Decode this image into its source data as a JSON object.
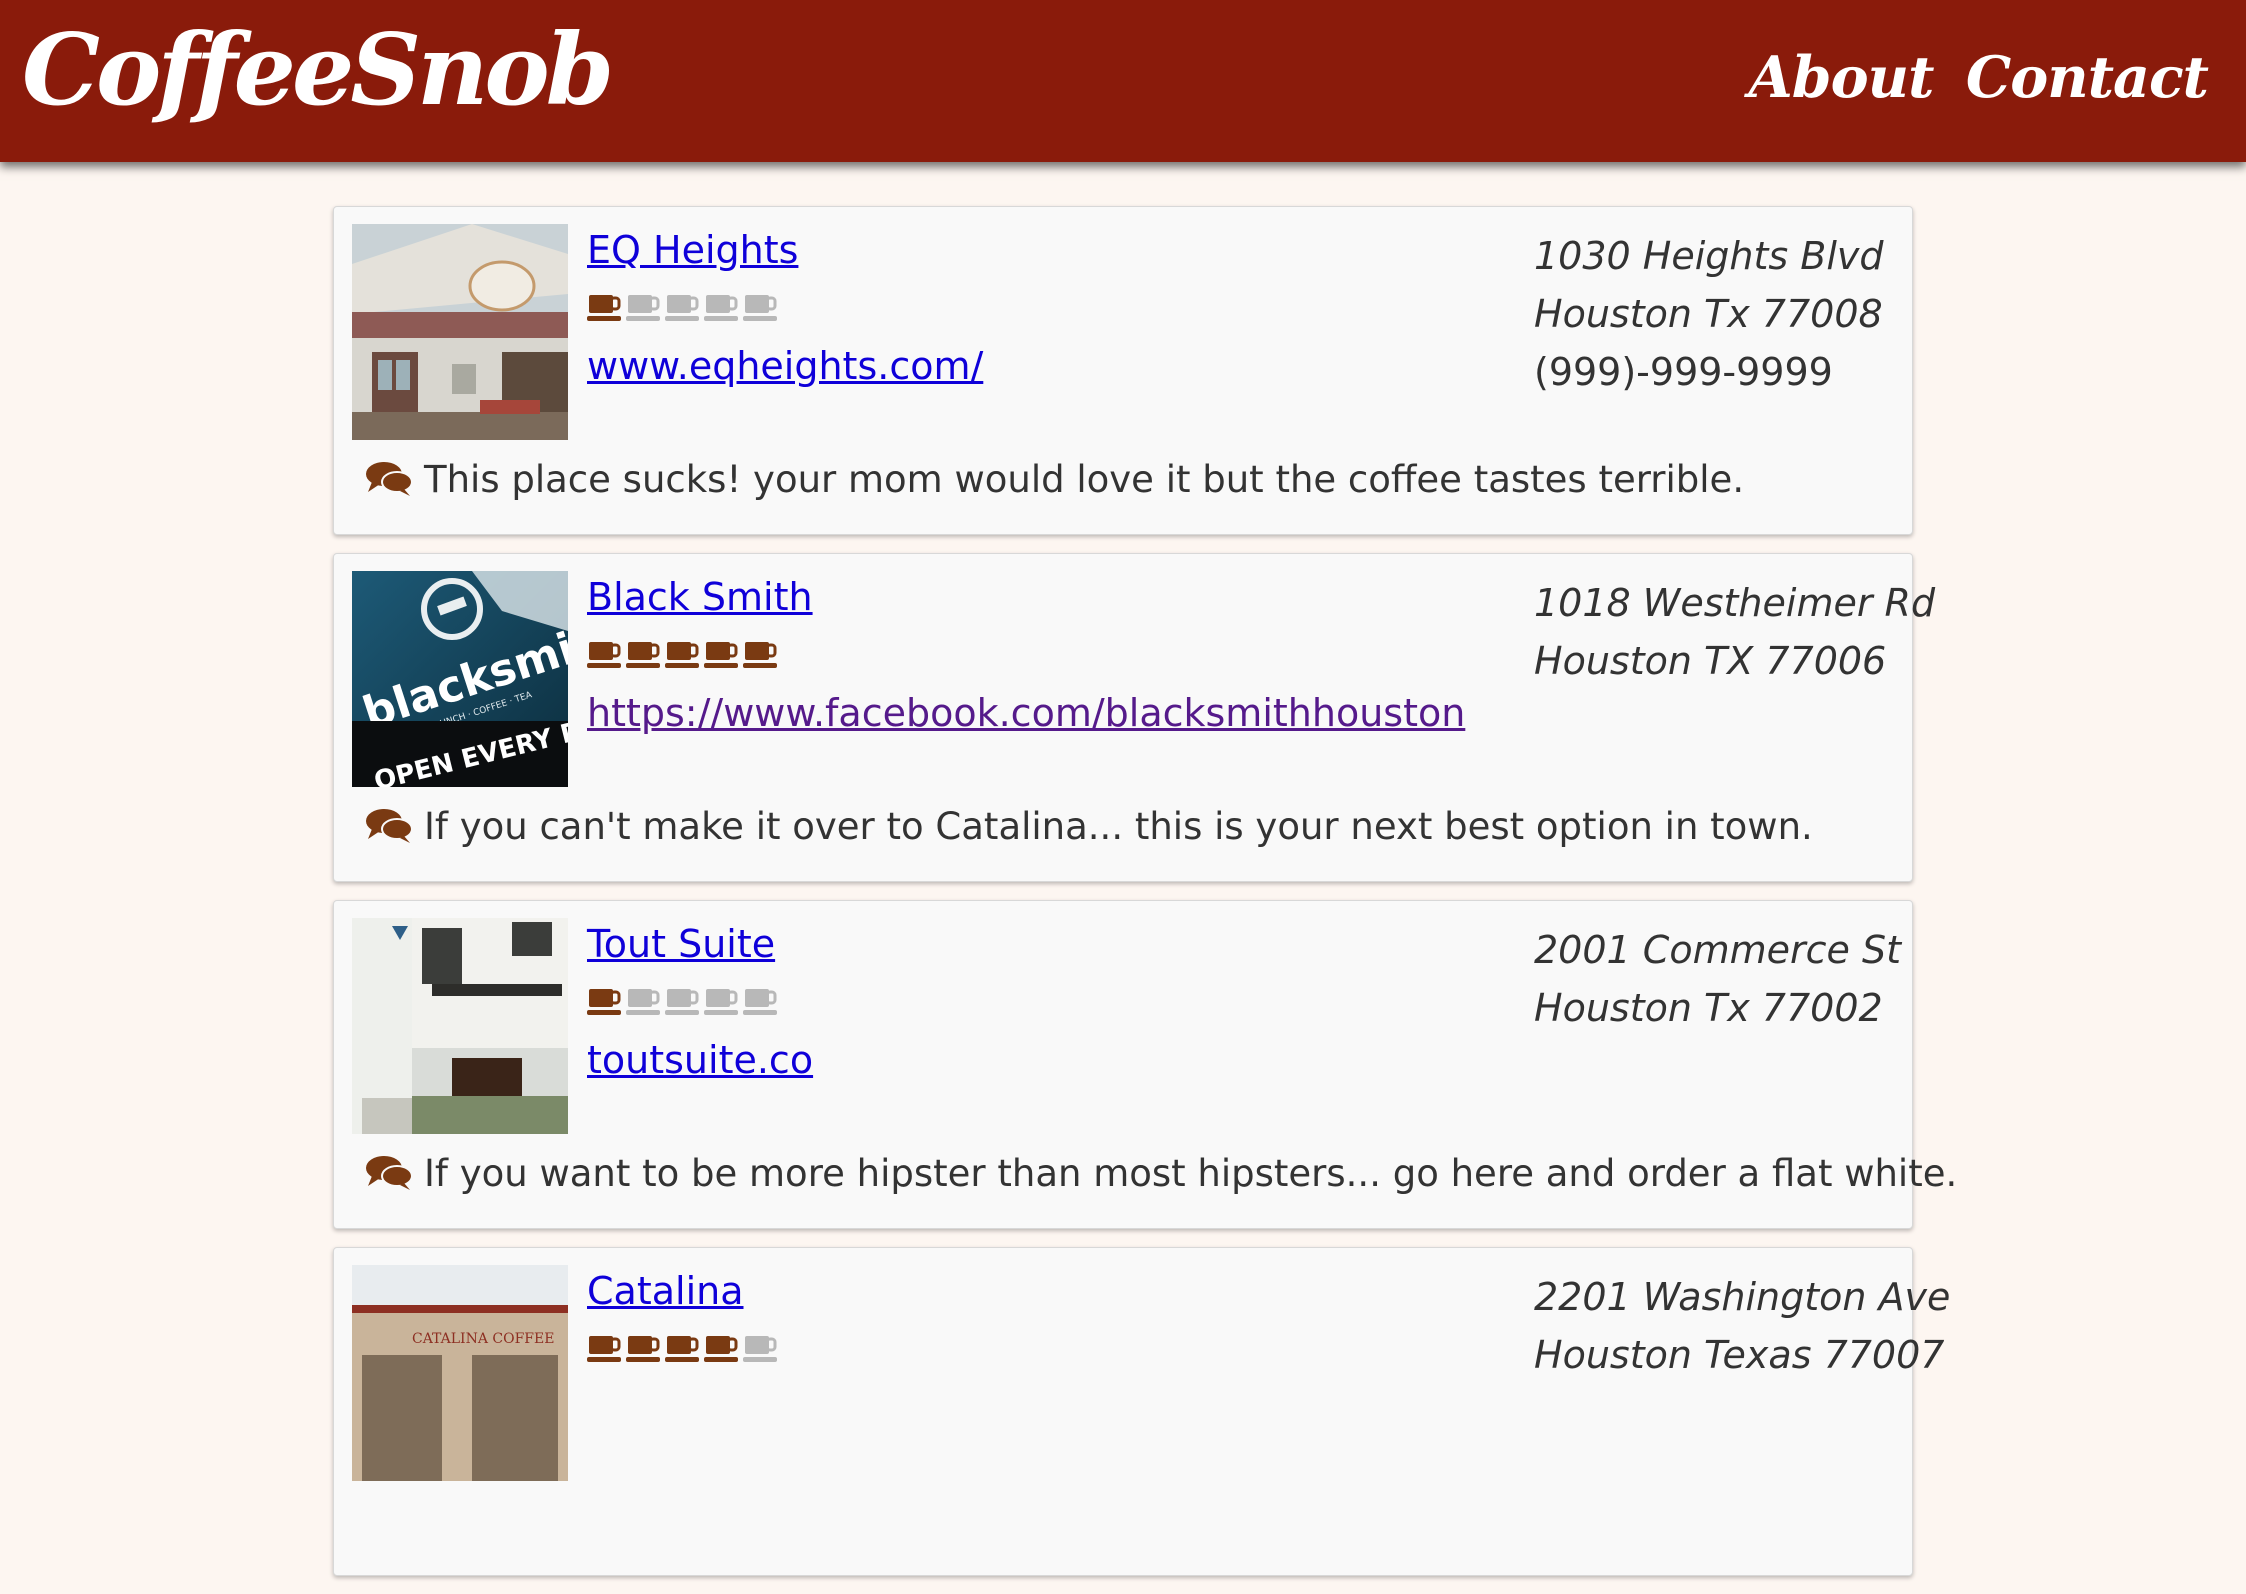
{
  "header": {
    "logo": "CoffeeSnob",
    "nav": [
      "About",
      "Contact"
    ]
  },
  "colors": {
    "header_bg": "#8a1b0b",
    "page_bg": "#fdf6f1",
    "cup_filled": "#7a3a12",
    "cup_empty": "#b8b8b8",
    "link": "#0f00d9"
  },
  "icons": {
    "rating": "coffee-cup-icon",
    "review": "comments-icon"
  },
  "shops": [
    {
      "name": "EQ Heights",
      "rating": 1,
      "rating_max": 5,
      "website": "www.eqheights.com/",
      "address_line1": "1030 Heights Blvd",
      "address_line2": "Houston Tx 77008",
      "phone": "(999)-999-9999",
      "review": "This place sucks! your mom would love it but the coffee tastes terrible."
    },
    {
      "name": "Black Smith",
      "rating": 5,
      "rating_max": 5,
      "website": "https://www.facebook.com/blacksmithhouston",
      "address_line1": "1018 Westheimer Rd",
      "address_line2": "Houston TX 77006",
      "phone": "",
      "review": "If you can't make it over to Catalina... this is your next best option in town.",
      "photo_text": [
        "blacksmith",
        "BREAKFAST · LUNCH · COFFEE · TEA",
        "OPEN EVERY DAY"
      ]
    },
    {
      "name": "Tout Suite",
      "rating": 1,
      "rating_max": 5,
      "website": "toutsuite.co",
      "address_line1": "2001 Commerce St",
      "address_line2": "Houston Tx 77002",
      "phone": "",
      "review": "If you want to be more hipster than most hipsters... go here and order a flat white."
    },
    {
      "name": "Catalina",
      "rating": 4,
      "rating_max": 5,
      "website": "",
      "address_line1": "2201 Washington Ave",
      "address_line2": "Houston Texas 77007",
      "phone": "",
      "review": "",
      "photo_text": [
        "CATALINA COFFEE"
      ]
    }
  ]
}
